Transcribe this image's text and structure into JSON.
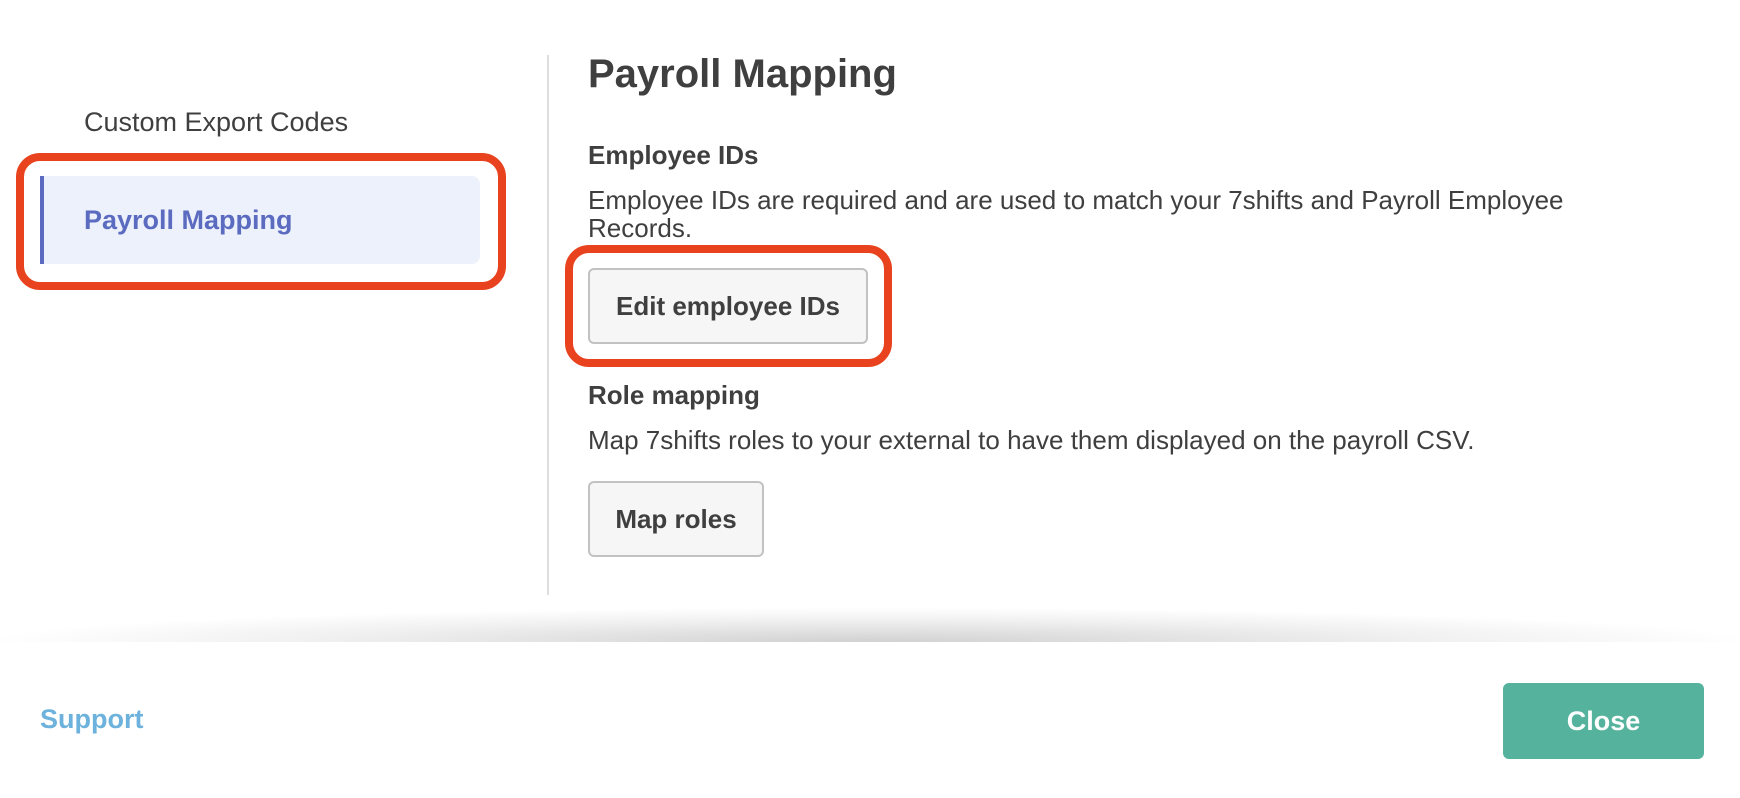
{
  "sidebar": {
    "items": [
      {
        "label": "Custom Export Codes",
        "active": false
      },
      {
        "label": "Payroll Mapping",
        "active": true
      }
    ]
  },
  "main": {
    "title": "Payroll Mapping",
    "sections": [
      {
        "heading": "Employee IDs",
        "description": "Employee IDs are required and are used to match your 7shifts and Payroll Employee Records.",
        "button_label": "Edit employee IDs"
      },
      {
        "heading": "Role mapping",
        "description": "Map 7shifts roles to your external to have them displayed on the payroll CSV.",
        "button_label": "Map roles"
      }
    ]
  },
  "footer": {
    "support_label": "Support",
    "close_label": "Close"
  },
  "colors": {
    "accent": "#5b6bc0",
    "active_bg": "#edf1fb",
    "primary_button": "#55b29d",
    "link": "#6cb2dc",
    "annotation": "#e8421e"
  }
}
